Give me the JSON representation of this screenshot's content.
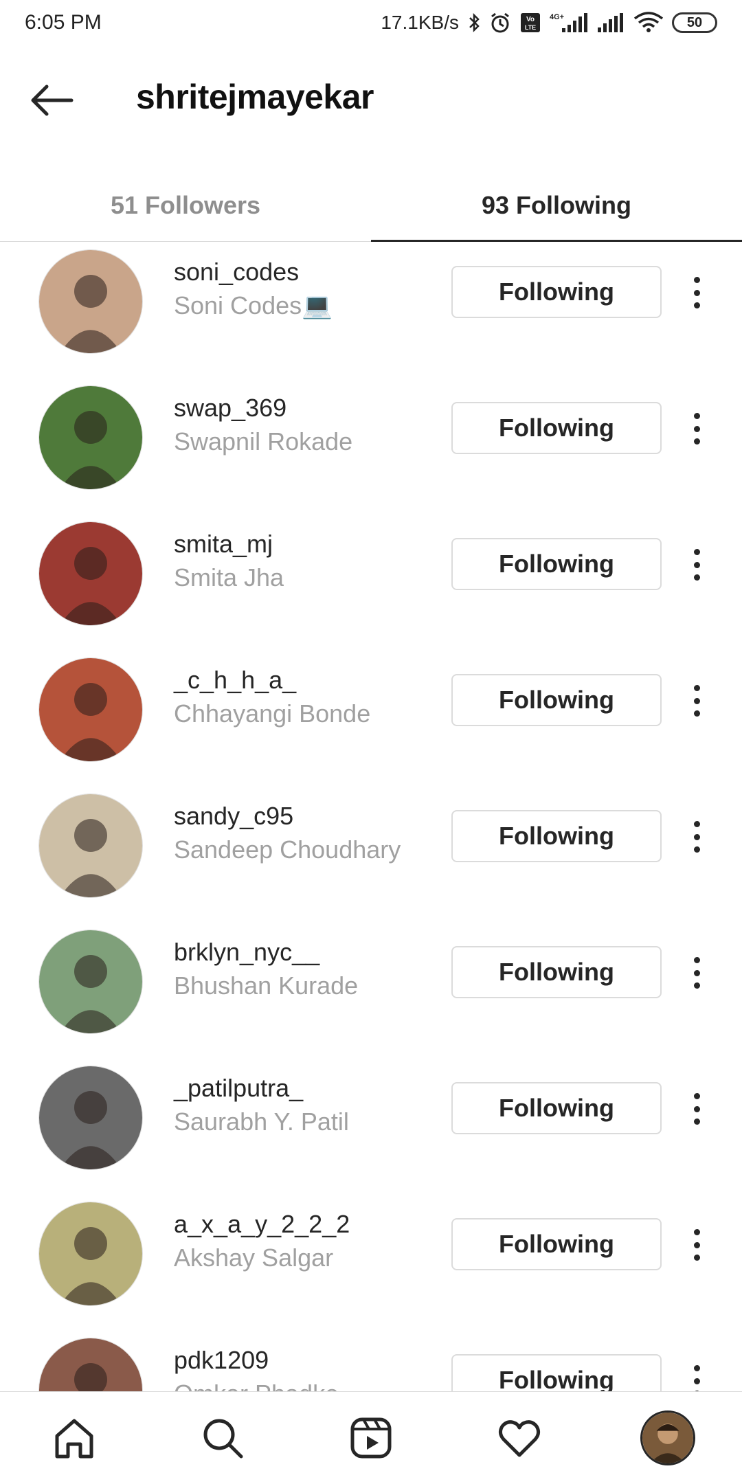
{
  "status_bar": {
    "time": "6:05 PM",
    "network_speed": "17.1KB/s",
    "battery": "50",
    "icons": [
      "bluetooth-icon",
      "alarm-icon",
      "volte-icon",
      "signal-4g-icon",
      "signal-icon",
      "wifi-icon",
      "battery-icon"
    ]
  },
  "header": {
    "title": "shritejmayekar",
    "back_icon": "arrow-left-icon"
  },
  "tabs": [
    {
      "label": "51 Followers",
      "active": false
    },
    {
      "label": "93 Following",
      "active": true
    }
  ],
  "following_list": [
    {
      "username": "soni_codes",
      "full_name": "Soni Codes💻",
      "button": "Following",
      "avatar_color": "#c9a58a"
    },
    {
      "username": "swap_369",
      "full_name": "Swapnil Rokade",
      "button": "Following",
      "avatar_color": "#4f7a3a"
    },
    {
      "username": "smita_mj",
      "full_name": "Smita Jha",
      "button": "Following",
      "avatar_color": "#9b3a32"
    },
    {
      "username": "_c_h_h_a_",
      "full_name": "Chhayangi Bonde",
      "button": "Following",
      "avatar_color": "#b5533a"
    },
    {
      "username": "sandy_c95",
      "full_name": "Sandeep Choudhary",
      "button": "Following",
      "avatar_color": "#cdbfa6"
    },
    {
      "username": "brklyn_nyc__",
      "full_name": "Bhushan Kurade",
      "button": "Following",
      "avatar_color": "#7fa07a"
    },
    {
      "username": "_patilputra_",
      "full_name": "Saurabh Y. Patil",
      "button": "Following",
      "avatar_color": "#6a6a6a"
    },
    {
      "username": "a_x_a_y_2_2_2",
      "full_name": "Akshay Salgar",
      "button": "Following",
      "avatar_color": "#b8b07a"
    },
    {
      "username": "pdk1209",
      "full_name": "Omkar Phadke",
      "button": "Following",
      "avatar_color": "#8a5a4a"
    }
  ],
  "bottom_nav": {
    "items": [
      "home-icon",
      "search-icon",
      "reels-icon",
      "heart-icon",
      "profile-avatar"
    ]
  }
}
